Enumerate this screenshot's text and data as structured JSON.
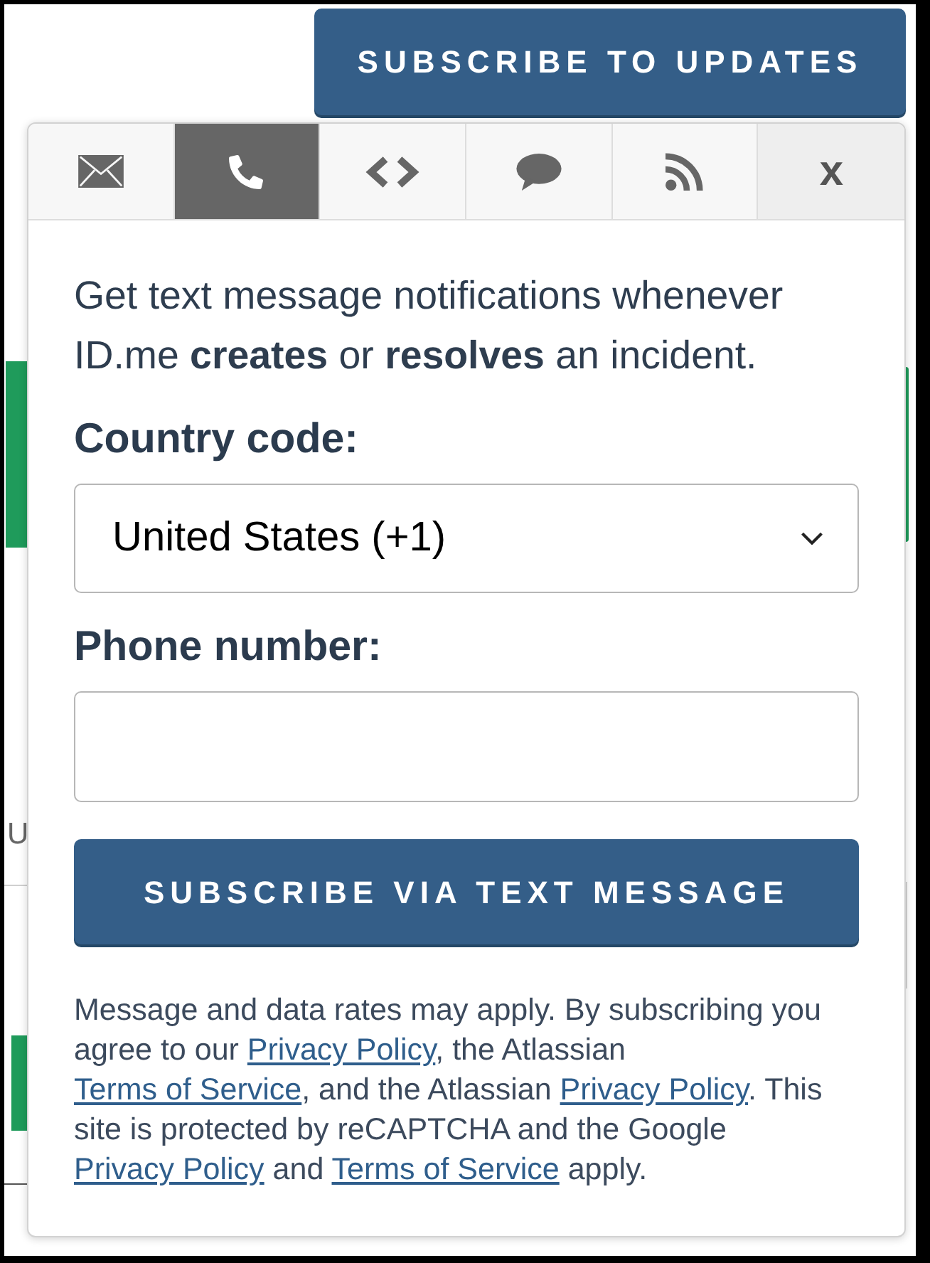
{
  "page": {
    "text_fragment": "U"
  },
  "subscribe_button": {
    "label": "SUBSCRIBE TO UPDATES"
  },
  "popup": {
    "tabs": [
      {
        "kind": "email",
        "selected": false
      },
      {
        "kind": "phone",
        "selected": true
      },
      {
        "kind": "code",
        "selected": false
      },
      {
        "kind": "chat",
        "selected": false
      },
      {
        "kind": "rss",
        "selected": false
      },
      {
        "kind": "close",
        "label": "x",
        "selected": false
      }
    ],
    "intro": "Get text message notifications whenever ID.me **creates** or **resolves** an incident.",
    "country_code": {
      "label": "Country code:",
      "value": "United States (+1)"
    },
    "phone_number": {
      "label": "Phone number:"
    },
    "submit_button": {
      "label": "SUBSCRIBE VIA TEXT MESSAGE"
    },
    "legal": [
      {
        "kind": "text",
        "text": "Message and data rates may apply. By subscribing you agree to our "
      },
      {
        "kind": "link",
        "text": "Privacy Policy"
      },
      {
        "kind": "text",
        "text": ", the Atlassian "
      },
      {
        "kind": "link",
        "text": "Terms of Service"
      },
      {
        "kind": "text",
        "text": ", and the Atlassian "
      },
      {
        "kind": "link",
        "text": "Privacy Policy"
      },
      {
        "kind": "text",
        "text": ". This site is protected by reCAPTCHA and the Google "
      },
      {
        "kind": "link",
        "text": "Privacy Policy"
      },
      {
        "kind": "text",
        "text": " and "
      },
      {
        "kind": "link",
        "text": "Terms of Service"
      },
      {
        "kind": "text",
        "text": " apply."
      }
    ]
  }
}
